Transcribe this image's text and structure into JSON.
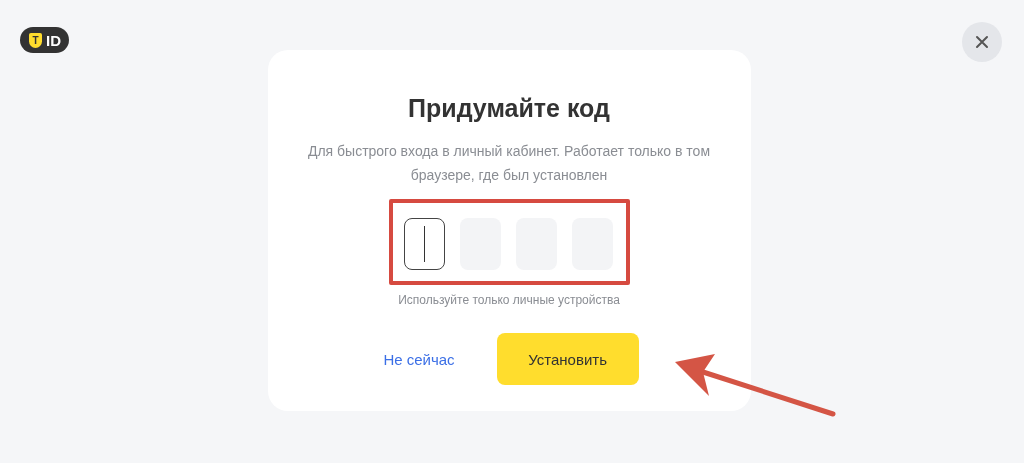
{
  "logo": {
    "letter": "T",
    "text": "ID"
  },
  "dialog": {
    "title": "Придумайте код",
    "description": "Для быстрого входа в личный кабинет. Работает только в том браузере, где был установлен",
    "code_cells": [
      {
        "focused": true
      },
      {
        "focused": false
      },
      {
        "focused": false
      },
      {
        "focused": false
      }
    ],
    "hint": "Используйте только личные устройства",
    "buttons": [
      {
        "kind": "link",
        "label": "Не сейчас"
      },
      {
        "kind": "primary",
        "label": "Установить"
      }
    ]
  }
}
